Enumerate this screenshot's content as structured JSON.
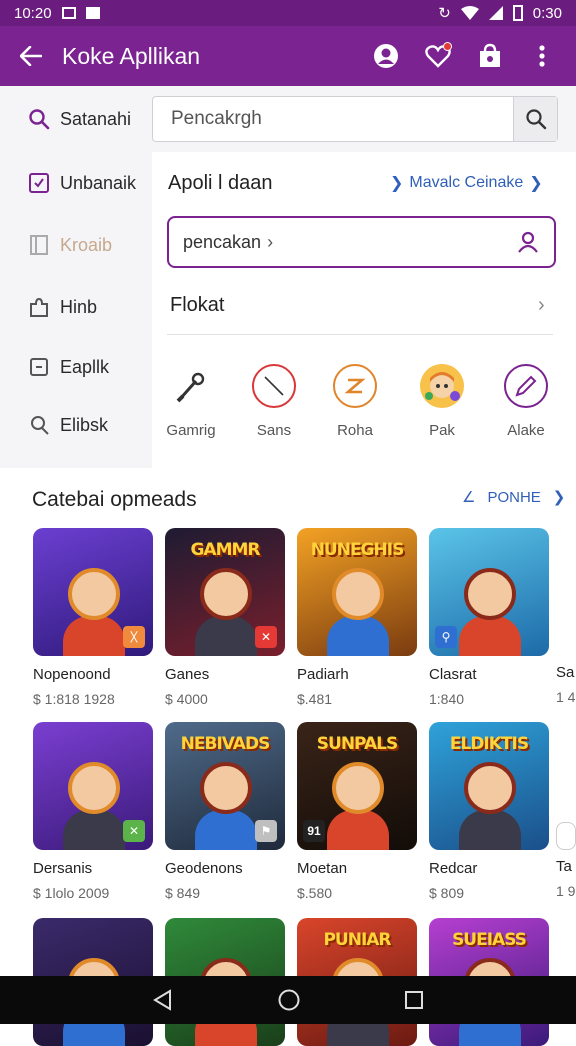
{
  "status_bar": {
    "time": "10:20",
    "right_time": "0:30"
  },
  "app_bar": {
    "title": "Koke Apllikan"
  },
  "search": {
    "placeholder": "Pencakrgh"
  },
  "sidebar": {
    "items": [
      {
        "label": "Satanahi",
        "icon": "search-icon"
      },
      {
        "label": "Unbanaik",
        "icon": "checkbox-icon"
      },
      {
        "label": "Kroaib",
        "icon": "book-icon"
      },
      {
        "label": "Hinb",
        "icon": "puzzle-icon"
      },
      {
        "label": "Eapllk",
        "icon": "box-icon"
      },
      {
        "label": "Elibsk",
        "icon": "location-icon"
      }
    ]
  },
  "main": {
    "section_title": "Apoli l daan",
    "section_link": "Mavalc Ceinake",
    "search2_text": "pencakan",
    "row_title": "Flokat",
    "categories": [
      {
        "label": "Gamrig",
        "icon": "joystick-icon",
        "color": "#333333"
      },
      {
        "label": "Sans",
        "icon": "compass-icon",
        "color": "#d9383a"
      },
      {
        "label": "Roha",
        "icon": "timer-icon",
        "color": "#e0852b"
      },
      {
        "label": "Pak",
        "icon": "character-icon",
        "color": "#e37b2a"
      },
      {
        "label": "Alake",
        "icon": "edit-icon",
        "color": "#7a2391"
      }
    ]
  },
  "apps_section": {
    "title": "Catebai opmeads",
    "link": "PONHE",
    "apps": [
      {
        "name": "Nopenoond",
        "price": "$ 1:818 1928",
        "banner": "",
        "bg1": "#6b3fd1",
        "bg2": "#2f1a7a",
        "badge": "ᚷ",
        "badge_color": "#f08a3c"
      },
      {
        "name": "Ganes",
        "price": "$ 4000",
        "banner": "GAMMR",
        "bg1": "#1e1b33",
        "bg2": "#7a1f2c",
        "badge": "✕",
        "badge_color": "#e53935"
      },
      {
        "name": "Padiarh",
        "price": "$.481",
        "banner": "NUNEGHIS",
        "bg1": "#f3a224",
        "bg2": "#7a3b10",
        "badge": "",
        "badge_color": ""
      },
      {
        "name": "Clasrat",
        "price": "1:840",
        "banner": "",
        "bg1": "#5bc4e8",
        "bg2": "#1c6aa8",
        "badge": "⚲",
        "badge_color": "#2f6fd1"
      },
      {
        "name": "Dersanis",
        "price": "$ 1lolo 2009",
        "banner": "",
        "bg1": "#7a3fd1",
        "bg2": "#3b1a7a",
        "badge": "✕",
        "badge_color": "#5bb34a"
      },
      {
        "name": "Geodenons",
        "price": "$ 849",
        "banner": "NEBIVADS",
        "bg1": "#4f6b8a",
        "bg2": "#1f2a3b",
        "badge": "⚑",
        "badge_color": "#bfbfbf"
      },
      {
        "name": "Moetan",
        "price": "$.580",
        "banner": "SUNPALS",
        "bg1": "#3a2418",
        "bg2": "#120c08",
        "badge": "91",
        "badge_color": "#222222"
      },
      {
        "name": "Redcar",
        "price": "$ 809",
        "banner": "ELDIKTIS",
        "bg1": "#2fa2d9",
        "bg2": "#1a4f8a",
        "badge": "",
        "badge_color": ""
      },
      {
        "name": "",
        "price": "",
        "banner": "",
        "bg1": "#3b2a6b",
        "bg2": "#1a1030",
        "badge": "",
        "badge_color": ""
      },
      {
        "name": "",
        "price": "",
        "banner": "",
        "bg1": "#2f8a3a",
        "bg2": "#1a3f1a",
        "badge": "",
        "badge_color": ""
      },
      {
        "name": "",
        "price": "",
        "banner": "PUNIAR",
        "bg1": "#d9452b",
        "bg2": "#6b1a12",
        "badge": "",
        "badge_color": ""
      },
      {
        "name": "",
        "price": "",
        "banner": "SUEIASS",
        "bg1": "#b63fd1",
        "bg2": "#3b1a7a",
        "badge": "",
        "badge_color": ""
      }
    ],
    "partial": [
      {
        "name": "Sa",
        "price": "1 4"
      },
      {
        "name": "Ta",
        "price": "1 9"
      }
    ]
  }
}
